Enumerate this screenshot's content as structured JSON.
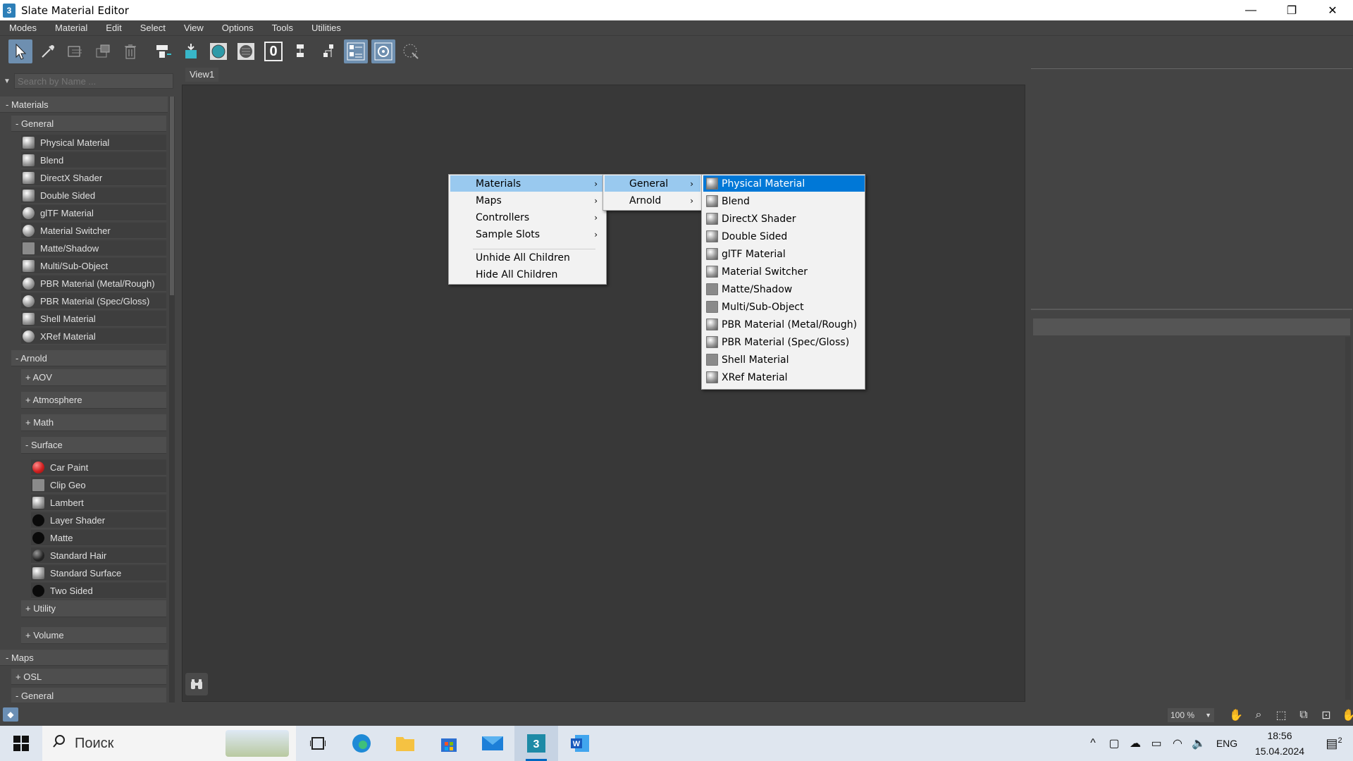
{
  "window": {
    "title": "Slate Material Editor",
    "app_icon": "3",
    "minimize": "—",
    "restore": "❐",
    "close": "✕"
  },
  "menubar": [
    "Modes",
    "Material",
    "Edit",
    "Select",
    "View",
    "Options",
    "Tools",
    "Utilities"
  ],
  "toolbar": {
    "icons": [
      "select-pointer-icon",
      "eyedropper-icon",
      "pick-material-icon",
      "put-to-scene-icon",
      "delete-icon",
      "move-children-icon",
      "assign-to-selection-icon",
      "show-shaded-icon",
      "background-icon",
      "zero-icon",
      "layout-icon",
      "layout-children-icon",
      "material-map-navigator-icon",
      "parameter-editor-icon",
      "select-by-material-icon"
    ],
    "zero_label": "0"
  },
  "browser": {
    "search_placeholder": "Search by Name ...",
    "tree": [
      {
        "type": "root",
        "label": "- Materials"
      },
      {
        "type": "cat",
        "label": "- General"
      },
      {
        "type": "leaf",
        "label": "Physical Material",
        "sw": "sph"
      },
      {
        "type": "leaf",
        "label": "Blend",
        "sw": "sph"
      },
      {
        "type": "leaf",
        "label": "DirectX Shader",
        "sw": "sph"
      },
      {
        "type": "leaf",
        "label": "Double Sided",
        "sw": "sph"
      },
      {
        "type": "leaf",
        "label": "glTF Material",
        "sw": "ball"
      },
      {
        "type": "leaf",
        "label": "Material Switcher",
        "sw": "ball"
      },
      {
        "type": "leaf",
        "label": "Matte/Shadow",
        "sw": "sq"
      },
      {
        "type": "leaf",
        "label": "Multi/Sub-Object",
        "sw": "sph"
      },
      {
        "type": "leaf",
        "label": "PBR Material (Metal/Rough)",
        "sw": "ball"
      },
      {
        "type": "leaf",
        "label": "PBR Material (Spec/Gloss)",
        "sw": "ball"
      },
      {
        "type": "leaf",
        "label": "Shell Material",
        "sw": "sph"
      },
      {
        "type": "leaf",
        "label": "XRef Material",
        "sw": "ball"
      },
      {
        "type": "cat",
        "label": "- Arnold"
      },
      {
        "type": "sub",
        "label": "+ AOV"
      },
      {
        "type": "sub",
        "label": "+ Atmosphere"
      },
      {
        "type": "sub",
        "label": "+ Math"
      },
      {
        "type": "sub",
        "label": "- Surface"
      },
      {
        "type": "leaf2",
        "label": "Car Paint",
        "sw": "red"
      },
      {
        "type": "leaf2",
        "label": "Clip Geo",
        "sw": "sq"
      },
      {
        "type": "leaf2",
        "label": "Lambert",
        "sw": "sph"
      },
      {
        "type": "leaf2",
        "label": "Layer Shader",
        "sw": "black"
      },
      {
        "type": "leaf2",
        "label": "Matte",
        "sw": "black"
      },
      {
        "type": "leaf2",
        "label": "Standard Hair",
        "sw": "hair"
      },
      {
        "type": "leaf2",
        "label": "Standard Surface",
        "sw": "sph"
      },
      {
        "type": "leaf2",
        "label": "Two Sided",
        "sw": "black"
      },
      {
        "type": "sub",
        "label": "+ Utility"
      },
      {
        "type": "sub",
        "label": "+ Volume"
      },
      {
        "type": "root",
        "label": "- Maps"
      },
      {
        "type": "cat",
        "label": "+ OSL"
      },
      {
        "type": "cat",
        "label": "- General"
      }
    ]
  },
  "view": {
    "tab": "View1",
    "binoculars_icon": "⌕"
  },
  "context_menu": {
    "level1": [
      "Materials",
      "Maps",
      "Controllers",
      "Sample Slots",
      "Unhide All Children",
      "Hide All Children"
    ],
    "level1_submenu": [
      true,
      true,
      true,
      true,
      false,
      false
    ],
    "level2": [
      "General",
      "Arnold"
    ],
    "level3": [
      "Physical Material",
      "Blend",
      "DirectX Shader",
      "Double Sided",
      "glTF Material",
      "Material Switcher",
      "Matte/Shadow",
      "Multi/Sub-Object",
      "PBR Material (Metal/Rough)",
      "PBR Material (Spec/Gloss)",
      "Shell Material",
      "XRef Material"
    ],
    "arrow": "›"
  },
  "statusbar": {
    "zoom": "100 %",
    "zoom_dd": "▼"
  },
  "taskbar": {
    "start_icon": "⊞",
    "search_label": "Поиск",
    "search_icon": "⌕",
    "lang": "ENG",
    "time": "18:56",
    "date": "15.04.2024",
    "notif_count": "2"
  },
  "colors": {
    "accent": "#0078d7",
    "hover": "#99c9ef",
    "bg": "#444444",
    "viewport": "#383838"
  }
}
